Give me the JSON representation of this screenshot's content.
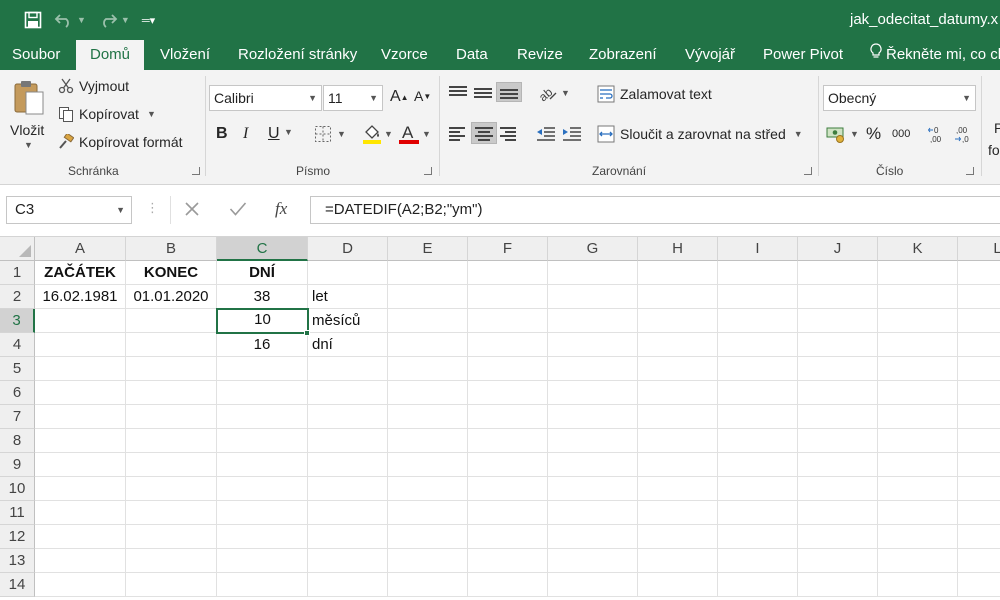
{
  "window": {
    "title": "jak_odecitat_datumy.x"
  },
  "ribbon_tabs": [
    {
      "label": "Soubor"
    },
    {
      "label": "Domů"
    },
    {
      "label": "Vložení"
    },
    {
      "label": "Rozložení stránky"
    },
    {
      "label": "Vzorce"
    },
    {
      "label": "Data"
    },
    {
      "label": "Revize"
    },
    {
      "label": "Zobrazení"
    },
    {
      "label": "Vývojář"
    },
    {
      "label": "Power Pivot"
    },
    {
      "label": "Řekněte mi, co ch"
    }
  ],
  "active_tab_index": 1,
  "ribbon": {
    "clipboard": {
      "paste_label": "Vložit",
      "cut_label": "Vyjmout",
      "copy_label": "Kopírovat",
      "format_painter_label": "Kopírovat formát",
      "group_label": "Schránka"
    },
    "font": {
      "font_name": "Calibri",
      "font_size": "11",
      "bold": "B",
      "italic": "I",
      "underline": "U",
      "group_label": "Písmo"
    },
    "alignment": {
      "wrap_label": "Zalamovat text",
      "merge_label": "Sloučit a zarovnat na střed",
      "group_label": "Zarovnání"
    },
    "number": {
      "format": "Obecný",
      "percent": "%",
      "thousands": "000",
      "group_label": "Číslo"
    },
    "styles_partial": {
      "line1": "P",
      "line2": "fo"
    }
  },
  "formula_bar": {
    "name_box": "C3",
    "fx": "fx",
    "formula": "=DATEDIF(A2;B2;\"ym\")"
  },
  "sheet": {
    "columns": [
      "A",
      "B",
      "C",
      "D",
      "E",
      "F",
      "G",
      "H",
      "I",
      "J",
      "K",
      "L"
    ],
    "rows": [
      "1",
      "2",
      "3",
      "4",
      "5",
      "6",
      "7",
      "8",
      "9",
      "10",
      "11",
      "12",
      "13",
      "14"
    ],
    "selected_column": "C",
    "selected_row": "3",
    "cells": {
      "A1": "ZAČÁTEK",
      "B1": "KONEC",
      "C1": "DNÍ",
      "A2": "16.02.1981",
      "B2": "01.01.2020",
      "C2": "38",
      "D2": "let",
      "C3": "10",
      "D3": "měsíců",
      "C4": "16",
      "D4": "dní"
    }
  },
  "colors": {
    "accent": "#217346",
    "selection_border": "#217346"
  }
}
